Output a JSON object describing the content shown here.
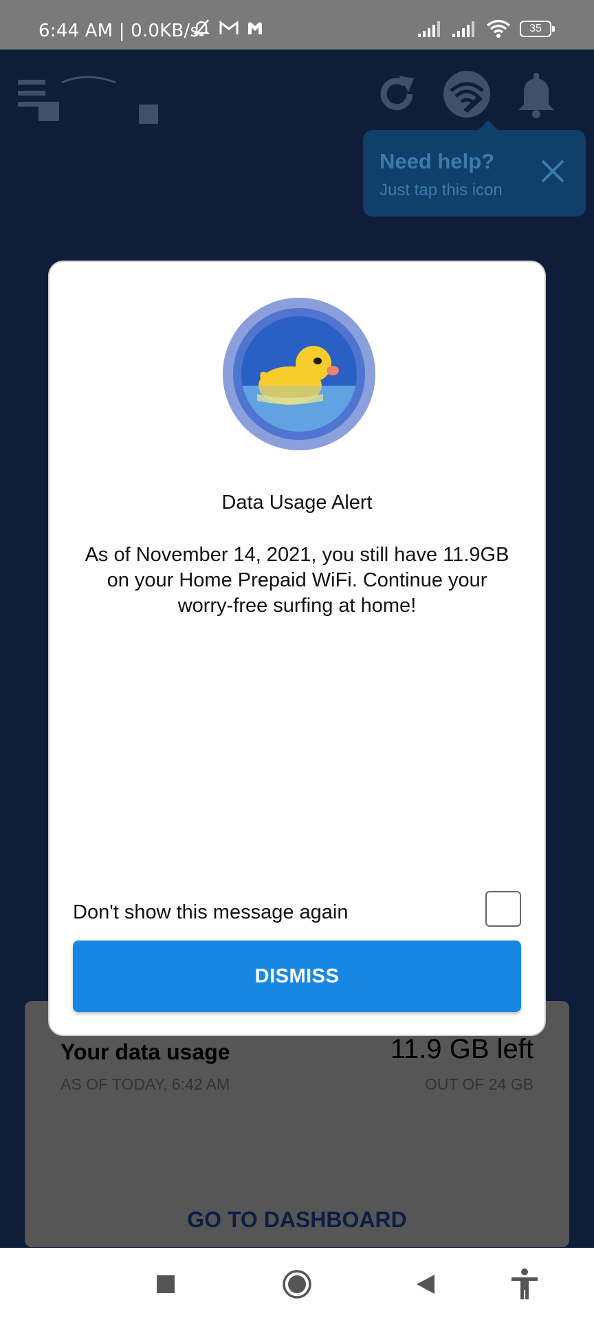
{
  "status_bar": {
    "time": "6:44 AM | 0.0KB/s",
    "battery": "35",
    "icons_left": [
      "mute-bell-icon",
      "gmail-icon",
      "malwarebytes-icon"
    ],
    "icons_right": [
      "signal-1-icon",
      "signal-2-icon",
      "wifi-icon",
      "battery-icon"
    ]
  },
  "header": {
    "icons": [
      "menu-icon",
      "refresh-icon",
      "wifi-help-icon",
      "notification-bell-icon"
    ]
  },
  "tooltip": {
    "title": "Need help?",
    "subtitle": "Just tap this icon"
  },
  "modal": {
    "icon": "duck-icon",
    "title": "Data Usage Alert",
    "body": "As of November 14, 2021, you still have 11.9GB on your Home Prepaid WiFi. Continue your worry-free surfing at home!",
    "checkbox_label": "Don't show this message again",
    "checkbox_checked": false,
    "dismiss_label": "DISMISS"
  },
  "usage_card": {
    "title": "Your data usage",
    "as_of": "AS OF TODAY, 6:42 AM",
    "left": "11.9 GB left",
    "total": "OUT OF 24 GB",
    "dashboard_link": "GO TO DASHBOARD"
  },
  "nav_bar": {
    "items": [
      "recents-icon",
      "home-icon",
      "back-icon",
      "accessibility-icon"
    ]
  },
  "colors": {
    "background": "#0f1d3a",
    "accent": "#1887e3",
    "tooltip": "#0f3f6a",
    "status_bar": "#7a7a7a"
  }
}
